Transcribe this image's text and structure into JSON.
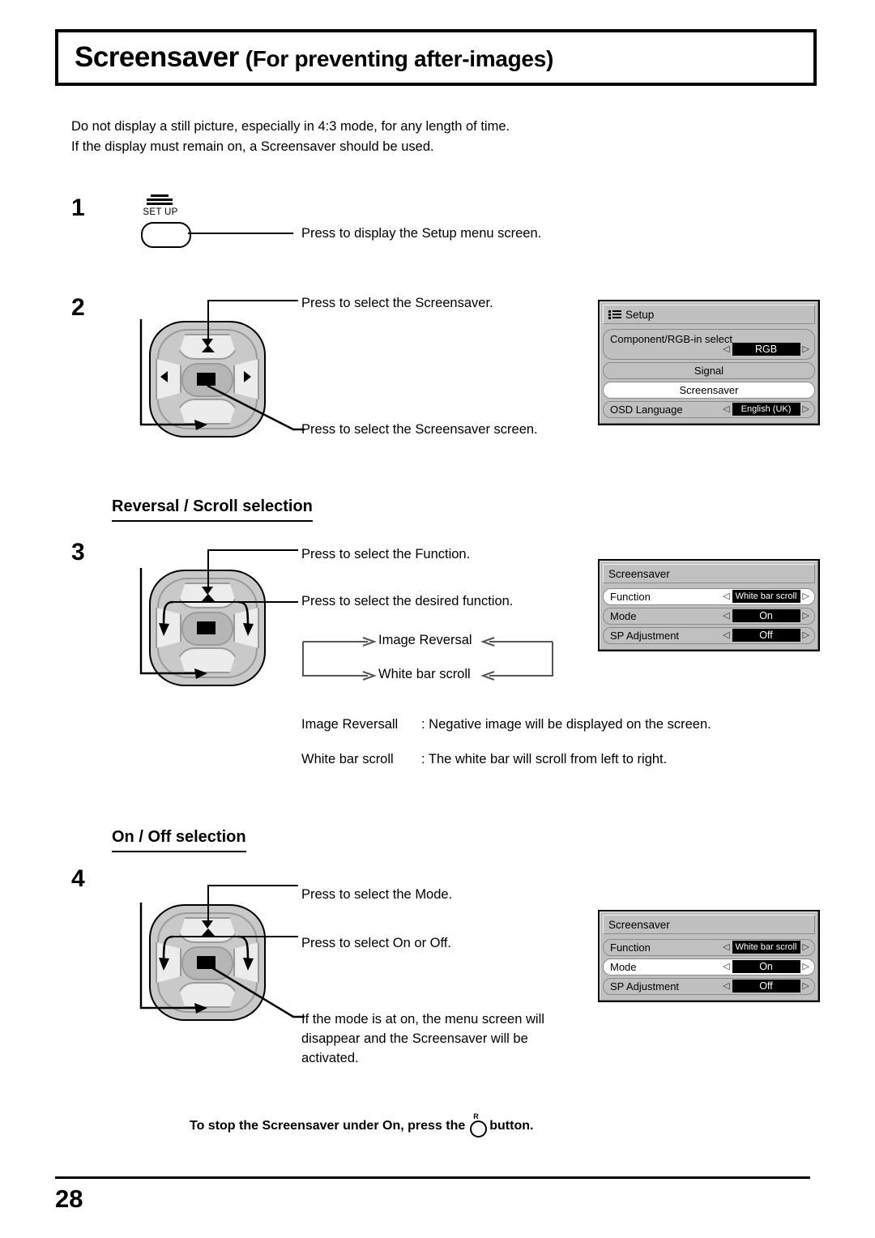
{
  "title": {
    "main": "Screensaver",
    "sub": "(For preventing after-images)"
  },
  "intro": {
    "line1": "Do not display a still picture, especially in 4:3 mode, for any length of time.",
    "line2": "If the display must remain on, a Screensaver should be used."
  },
  "steps": {
    "one": {
      "number": "1",
      "button_label": "SET UP",
      "caption": "Press to display the Setup menu screen."
    },
    "two": {
      "number": "2",
      "caption_top": "Press to select the Screensaver.",
      "caption_bottom": "Press to select the Screensaver screen."
    },
    "three": {
      "number": "3",
      "caption_top": "Press to select the Function.",
      "caption_mid": "Press to select the desired function."
    },
    "four": {
      "number": "4",
      "caption_top": "Press to select the Mode.",
      "caption_mid": "Press to select On or Off.",
      "caption_bottom": "If the mode is at on, the menu screen will disappear and the Screensaver will be activated."
    }
  },
  "sections": {
    "reversal_scroll": "Reversal / Scroll selection",
    "on_off": "On / Off selection"
  },
  "loop": {
    "option1": "Image Reversal",
    "option2": "White bar scroll"
  },
  "definitions": [
    {
      "term": "Image Reversall",
      "sep": ": ",
      "desc": "Negative image will be displayed on the screen."
    },
    {
      "term": "White bar scroll",
      "sep": ": ",
      "desc": "The white bar will scroll from left to right."
    }
  ],
  "osd_setup": {
    "header": "Setup",
    "rows": [
      {
        "name": "Component/RGB-in select",
        "value": "RGB",
        "selected": false
      },
      {
        "name": "Signal",
        "value": "",
        "selected": false
      },
      {
        "name": "Screensaver",
        "value": "",
        "selected": true
      },
      {
        "name": "OSD  Language",
        "value": "English (UK)",
        "selected": false
      }
    ],
    "left_arrow": "◁",
    "right_arrow": "▷"
  },
  "osd_screensaver_step3": {
    "header": "Screensaver",
    "rows": [
      {
        "name": "Function",
        "value": "White bar scroll",
        "selected": true
      },
      {
        "name": "Mode",
        "value": "On",
        "selected": false
      },
      {
        "name": "SP Adjustment",
        "value": "Off",
        "selected": false
      }
    ]
  },
  "osd_screensaver_step4": {
    "header": "Screensaver",
    "rows": [
      {
        "name": "Function",
        "value": "White bar scroll",
        "selected": false
      },
      {
        "name": "Mode",
        "value": "On",
        "selected": true
      },
      {
        "name": "SP Adjustment",
        "value": "Off",
        "selected": false
      }
    ]
  },
  "footer_note": {
    "before": "To stop the Screensaver under On, press the",
    "button": "R",
    "after": "button."
  },
  "footer": {
    "page_number": "28"
  }
}
